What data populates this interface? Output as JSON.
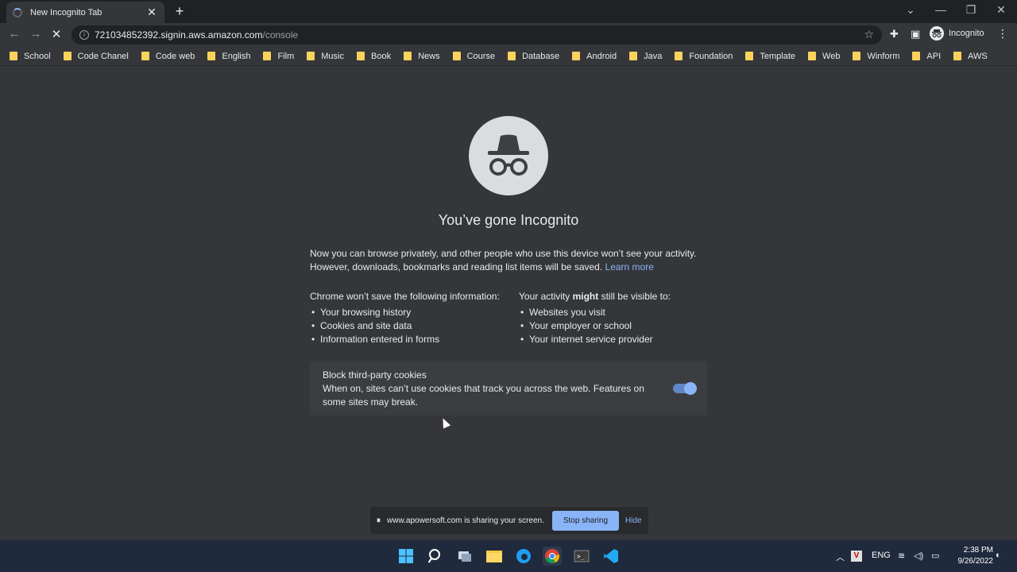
{
  "tab": {
    "title": "New Incognito Tab"
  },
  "omnibox": {
    "url_host": "721034852392.signin.aws.amazon.com",
    "url_path": "/console"
  },
  "profile": {
    "label": "Incognito"
  },
  "bookmarks": [
    "School",
    "Code Chanel",
    "Code web",
    "English",
    "Film",
    "Music",
    "Book",
    "News",
    "Course",
    "Database",
    "Android",
    "Java",
    "Foundation",
    "Template",
    "Web",
    "Winform",
    "API",
    "AWS"
  ],
  "page": {
    "heading": "You’ve gone Incognito",
    "para1": "Now you can browse privately, and other people who use this device won’t see your activity. However, downloads, bookmarks and reading list items will be saved.",
    "learn_more": "Learn more",
    "left_header": "Chrome won’t save the following information:",
    "left_items": [
      "Your browsing history",
      "Cookies and site data",
      "Information entered in forms"
    ],
    "right_header_pre": "Your activity ",
    "right_header_bold": "might",
    "right_header_post": " still be visible to:",
    "right_items": [
      "Websites you visit",
      "Your employer or school",
      "Your internet service provider"
    ],
    "cookies_title": "Block third-party cookies",
    "cookies_desc": "When on, sites can’t use cookies that track you across the web. Features on some sites may break.",
    "cookies_enabled": true
  },
  "share_bar": {
    "message": "www.apowersoft.com is sharing your screen.",
    "stop_label": "Stop sharing",
    "hide_label": "Hide"
  },
  "taskbar": {
    "lang": "ENG",
    "time": "2:38 PM",
    "date": "9/26/2022"
  },
  "colors": {
    "accent": "#8ab4f8",
    "folder": "#f9d35b",
    "background": "#35363a"
  }
}
